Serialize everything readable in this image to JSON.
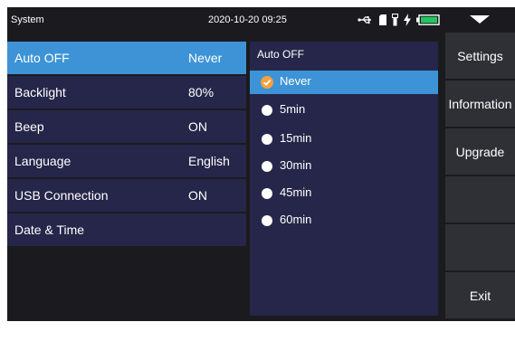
{
  "status": {
    "title": "System",
    "datetime": "2020-10-20 09:25",
    "icons": [
      "usb-icon",
      "sd-card-icon",
      "flashlight-icon",
      "charging-icon",
      "battery-icon"
    ],
    "battery_color": "#22c55e"
  },
  "settings": [
    {
      "label": "Auto OFF",
      "value": "Never",
      "selected": true
    },
    {
      "label": "Backlight",
      "value": "80%",
      "selected": false
    },
    {
      "label": "Beep",
      "value": "ON",
      "selected": false
    },
    {
      "label": "Language",
      "value": "English",
      "selected": false
    },
    {
      "label": "USB Connection",
      "value": "ON",
      "selected": false
    },
    {
      "label": "Date & Time",
      "value": "",
      "selected": false
    }
  ],
  "panel": {
    "title": "Auto OFF",
    "options": [
      {
        "label": "Never",
        "selected": true
      },
      {
        "label": "5min",
        "selected": false
      },
      {
        "label": "15min",
        "selected": false
      },
      {
        "label": "30min",
        "selected": false
      },
      {
        "label": "45min",
        "selected": false
      },
      {
        "label": "60min",
        "selected": false
      }
    ]
  },
  "menu": {
    "settings": "Settings",
    "information": "Information",
    "upgrade": "Upgrade",
    "exit": "Exit"
  },
  "colors": {
    "accent": "#3d93d6",
    "row_bg": "#26264a",
    "check": "#f5a03c"
  }
}
